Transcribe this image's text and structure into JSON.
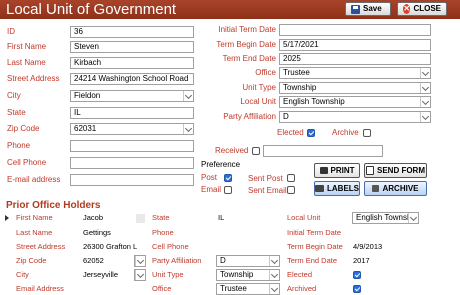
{
  "header": {
    "title": "Local Unit of Government",
    "save_label": "Save",
    "close_label": "CLOSE"
  },
  "form": {
    "id": {
      "label": "ID",
      "value": "36"
    },
    "first_name": {
      "label": "First Name",
      "value": "Steven"
    },
    "last_name": {
      "label": "Last Name",
      "value": "Kirbach"
    },
    "street_address": {
      "label": "Street Address",
      "value": "24214 Washington School Road"
    },
    "city": {
      "label": "City",
      "value": "Fieldon"
    },
    "state": {
      "label": "State",
      "value": "IL"
    },
    "zip_code": {
      "label": "Zip Code",
      "value": "62031"
    },
    "phone": {
      "label": "Phone",
      "value": ""
    },
    "cell_phone": {
      "label": "Cell Phone",
      "value": ""
    },
    "email": {
      "label": "E-mail address",
      "value": ""
    },
    "initial_term_date": {
      "label": "Initial Term Date",
      "value": ""
    },
    "term_begin_date": {
      "label": "Term Begin Date",
      "value": "5/17/2021"
    },
    "term_end_date": {
      "label": "Term End Date",
      "value": "2025"
    },
    "office": {
      "label": "Office",
      "value": "Trustee"
    },
    "unit_type": {
      "label": "Unit Type",
      "value": "Township"
    },
    "local_unit": {
      "label": "Local Unit",
      "value": "English Township"
    },
    "party_affiliation": {
      "label": "Party Affiliation",
      "value": "D"
    },
    "elected": {
      "label": "Elected",
      "checked": true
    },
    "archive": {
      "label": "Archive",
      "checked": false
    },
    "received": {
      "label": "Received",
      "checked": false,
      "value": ""
    }
  },
  "preference": {
    "label": "Preference",
    "post": {
      "label": "Post",
      "checked": true
    },
    "email": {
      "label": "Email",
      "checked": false
    },
    "sent_post": {
      "label": "Sent Post",
      "checked": false
    },
    "sent_email": {
      "label": "Sent Email",
      "checked": false
    }
  },
  "actions": {
    "print": "PRINT",
    "send_form": "SEND FORM",
    "labels": "LABELS",
    "archive": "ARCHIVE"
  },
  "prior": {
    "title": "Prior Office Holders",
    "labels": {
      "first_name": "First Name",
      "last_name": "Last Name",
      "street_address": "Street Address",
      "zip_code": "Zip Code",
      "city": "City",
      "email_address": "Email Address",
      "state": "State",
      "phone": "Phone",
      "cell_phone": "Cell Phone",
      "party_affiliation": "Party Affiliation",
      "unit_type": "Unit Type",
      "office": "Office",
      "local_unit": "Local Unit",
      "initial_term_date": "Initial Term Date",
      "term_begin_date": "Term Begin Date",
      "term_end_date": "Term End Date",
      "elected": "Elected",
      "archived": "Archived"
    },
    "record": {
      "first_name": "Jacob",
      "last_name": "Gettings",
      "street_address": "26300 Grafton L",
      "zip_code": "62052",
      "city": "Jerseyville",
      "email_address": "",
      "state": "IL",
      "phone": "",
      "cell_phone": "",
      "party_affiliation": "D",
      "unit_type": "Township",
      "office": "Trustee",
      "local_unit": "English Townsh",
      "initial_term_date": "",
      "term_begin_date": "4/9/2013",
      "term_end_date": "2017",
      "elected": true,
      "archived": true
    }
  }
}
